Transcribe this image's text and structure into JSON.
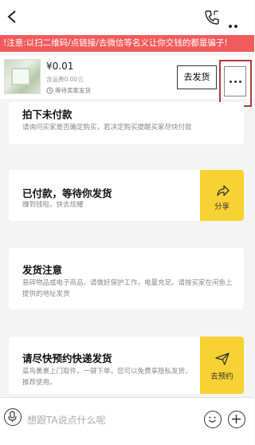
{
  "warning": {
    "text": "!注意:以扫二维码/点链接/去微信等名义让你交钱的都是骗子!"
  },
  "order": {
    "price": "¥0.01",
    "shipping_fee": "含运费0.00元",
    "status": "等待卖家发货",
    "ship_button": "去发货"
  },
  "cards": [
    {
      "title": "拍下未付款",
      "desc": "请询问买家是否确定购买，若决定购买提醒买家尽快付款"
    },
    {
      "title": "已付款，等待你发货",
      "desc": "赚到钱啦，快去炫耀",
      "action_label": "分享",
      "action_icon": "share-icon"
    },
    {
      "title": "发货注意",
      "desc": "易碎物品或电子商品，请做好保护工作，电量充足。请按买家在闲鱼上提供的地址发货"
    },
    {
      "title": "请尽快预约快递发货",
      "desc": "菜鸟裹裹上门取件，一键下单，您可以免费享隐私发货，推荐使用。",
      "action_label": "去预约",
      "action_icon": "send-icon"
    }
  ],
  "input": {
    "placeholder": "想跟TA说点什么呢"
  },
  "colors": {
    "warning_bg": "#f25b5b",
    "accent_yellow": "#f7d233",
    "highlight_border": "#b03a3a"
  }
}
